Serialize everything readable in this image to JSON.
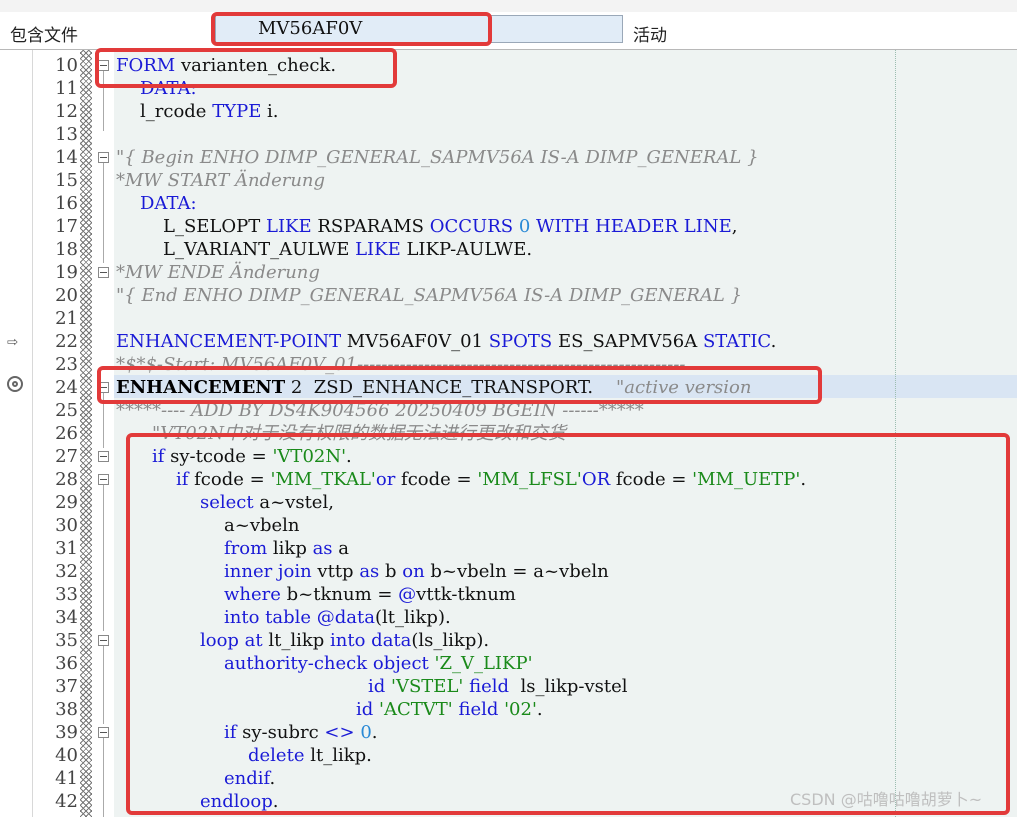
{
  "header": {
    "include_label": "包含文件",
    "include_value": "MV56AF0V",
    "status": "活动"
  },
  "line_numbers": [
    "10",
    "11",
    "12",
    "13",
    "14",
    "15",
    "16",
    "17",
    "18",
    "19",
    "20",
    "21",
    "22",
    "23",
    "24",
    "25",
    "26",
    "27",
    "28",
    "29",
    "30",
    "31",
    "32",
    "33",
    "34",
    "35",
    "36",
    "37",
    "38",
    "39",
    "40",
    "41",
    "42"
  ],
  "code_tokens": {
    "l10": [
      "FORM",
      " varianten_check."
    ],
    "l11": [
      "DATA:"
    ],
    "l12": [
      "l_rcode ",
      "TYPE",
      " i."
    ],
    "l14": [
      "\"{ Begin ENHO DIMP_GENERAL_SAPMV56A IS-A DIMP_GENERAL }"
    ],
    "l15": [
      "*MW START Änderung"
    ],
    "l16": [
      "DATA:"
    ],
    "l17": [
      "L_SELOPT ",
      "LIKE",
      " RSPARAMS ",
      "OCCURS",
      " ",
      "0",
      " ",
      "WITH HEADER LINE",
      ","
    ],
    "l18": [
      "L_VARIANT_AULWE ",
      "LIKE",
      " LIKP-AULWE."
    ],
    "l19": [
      "*MW ENDE Änderung"
    ],
    "l20": [
      "\"{ End ENHO DIMP_GENERAL_SAPMV56A IS-A DIMP_GENERAL }"
    ],
    "l22": [
      "ENHANCEMENT-POINT",
      " MV56AF0V_01 ",
      "SPOTS",
      " ES_SAPMV56A ",
      "STATIC",
      "."
    ],
    "l23": [
      "*$*$-Start: MV56AF0V_01------------------------------------------------------"
    ],
    "l24": [
      "ENHANCEMENT",
      " 2  ZSD_ENHANCE_TRANSPORT.",
      "    \"active version"
    ],
    "l25": [
      "*****---- ADD BY DS4K904566 20250409 BGEIN ------*****"
    ],
    "l26": [
      "\"VT02N中对于没有权限的数据无法进行更改和交货"
    ],
    "l27": [
      "if",
      " sy-tcode = ",
      "'VT02N'",
      "."
    ],
    "l28": [
      "if",
      " fcode = ",
      "'MM_TKAL'",
      "or",
      " fcode = ",
      "'MM_LFSL'",
      "OR",
      " fcode = ",
      "'MM_UETP'",
      "."
    ],
    "l29": [
      "select",
      " a~vstel,"
    ],
    "l30": [
      "a~vbeln"
    ],
    "l31": [
      "from",
      " likp ",
      "as",
      " a"
    ],
    "l32": [
      "inner join",
      " vttp ",
      "as",
      " b ",
      "on",
      " b~vbeln = a~vbeln"
    ],
    "l33": [
      "where",
      " b~tknum = ",
      "@",
      "vttk-tknum"
    ],
    "l34": [
      "into table",
      " ",
      "@data",
      "(lt_likp)."
    ],
    "l35": [
      "loop at",
      " lt_likp ",
      "into data",
      "(ls_likp)."
    ],
    "l36": [
      "authority-check object",
      " ",
      "'Z_V_LIKP'"
    ],
    "l37": [
      "id",
      " ",
      "'VSTEL'",
      " ",
      "field",
      "  ls_likp-vstel"
    ],
    "l38": [
      "id",
      " ",
      "'ACTVT'",
      " ",
      "field",
      " ",
      "'02'",
      "."
    ],
    "l39": [
      "if",
      " sy-subrc ",
      "<>",
      " ",
      "0",
      "."
    ],
    "l40": [
      "delete",
      " lt_likp."
    ],
    "l41": [
      "endif",
      "."
    ],
    "l42": [
      "endloop",
      "."
    ]
  },
  "watermark": "CSDN @咕噜咕噜胡萝卜~",
  "colors": {
    "keyword": "#1a1ad6",
    "string": "#1a8a1a",
    "number": "#2a8ad6",
    "comment": "#8a8a8a",
    "highlight": "#e23a3a"
  }
}
